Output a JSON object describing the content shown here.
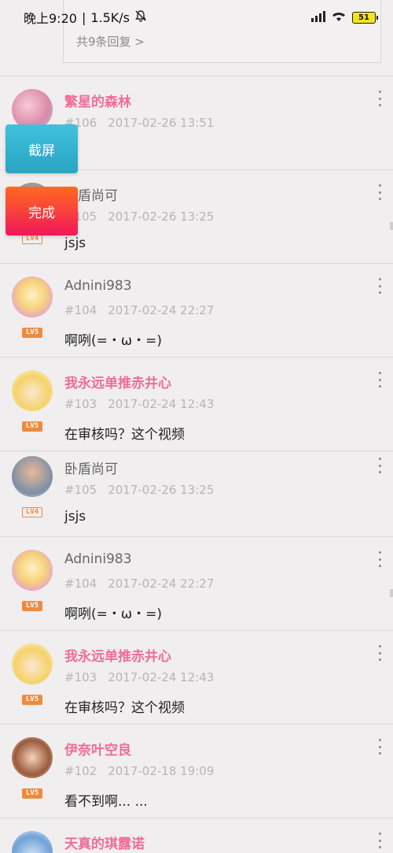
{
  "status_bar": {
    "time": "晚上9:20",
    "network_speed": "1.5K/s",
    "battery": "51",
    "icons": [
      "mute-icon",
      "signal-icon",
      "wifi-icon",
      "battery-icon"
    ]
  },
  "reply_box": {
    "more_replies": "共9条回复 >"
  },
  "float_buttons": {
    "screenshot": "截屏",
    "done": "完成"
  },
  "comments": [
    {
      "username": "繁星的森林",
      "floor": "#106",
      "time": "2017-02-26 13:51",
      "content": "",
      "level": "",
      "name_color": "pink"
    },
    {
      "username": "卧盾尚可",
      "floor": "#105",
      "time": "2017-02-26 13:25",
      "content": "jsjs",
      "level": "LV4",
      "name_color": "gray"
    },
    {
      "username": "Adnini983",
      "floor": "#104",
      "time": "2017-02-24 22:27",
      "content": "啊咧(=・ω・=)",
      "level": "LV5",
      "name_color": "gray"
    },
    {
      "username": "我永远单推赤井心",
      "floor": "#103",
      "time": "2017-02-24 12:43",
      "content": "在审核吗？这个视频",
      "level": "LV5",
      "name_color": "pink"
    },
    {
      "username": "卧盾尚可",
      "floor": "#105",
      "time": "2017-02-26 13:25",
      "content": "jsjs",
      "level": "LV4",
      "name_color": "gray"
    },
    {
      "username": "Adnini983",
      "floor": "#104",
      "time": "2017-02-24 22:27",
      "content": "啊咧(=・ω・=)",
      "level": "LV5",
      "name_color": "gray"
    },
    {
      "username": "我永远单推赤井心",
      "floor": "#103",
      "time": "2017-02-24 12:43",
      "content": "在审核吗？这个视频",
      "level": "LV5",
      "name_color": "pink"
    },
    {
      "username": "伊奈叶空良",
      "floor": "#102",
      "time": "2017-02-18 19:09",
      "content": "看不到啊... ...",
      "level": "LV5",
      "name_color": "pink"
    },
    {
      "username": "天真的琪露诺",
      "floor": "",
      "time": "",
      "content": "",
      "level": "",
      "name_color": "pink"
    }
  ],
  "colors": {
    "pink": "#f06d97",
    "level_orange": "#f08a3c",
    "screenshot_btn": "#3fc2dc",
    "done_btn": "#f1185a"
  }
}
